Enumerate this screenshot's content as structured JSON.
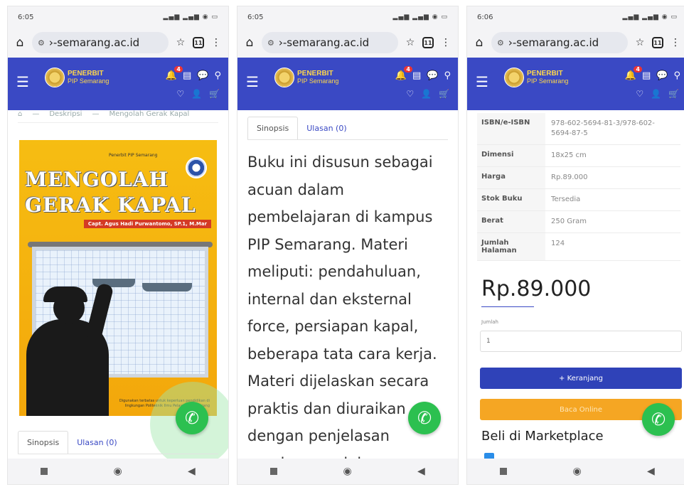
{
  "status": {
    "time1": "6:05",
    "time2": "6:05",
    "time3": "6:06",
    "signal": "▂▄▆ ▂▄▆ ■"
  },
  "browser": {
    "url": "›-semarang.ac.id",
    "tabs_count": "11"
  },
  "brand": {
    "line1": "PENERBIT",
    "line2": "PIP Semarang"
  },
  "nav": {
    "notif_count": "4"
  },
  "breadcrumb": {
    "item1": "⌂",
    "item2": "Deskripsi",
    "item3": "Mengolah Gerak Kapal"
  },
  "cover": {
    "publisher": "Penerbit PIP Semarang",
    "title_line1": "MENGOLAH",
    "title_line2": "GERAK KAPAL",
    "author": "Capt. Agus Hadi Purwantomo, SP.1, M.Mar",
    "footer_note": "Digunakan terbatas untuk keperluan pendidikan di lingkungan Politeknik Ilmu Pelayaran Semarang"
  },
  "tabs": {
    "synopsis": "Sinopsis",
    "reviews": "Ulasan (0)"
  },
  "synopsis_text": "Buku ini disusun sebagai acuan dalam pembelajaran di kampus PIP Semarang. Materi meliputi: pendahuluan, internal dan eksternal force, persiapan kapal, beberapa tata cara kerja. Materi dijelaskan secara praktis dan diuraikan dengan penjelasan gambar pendukung.",
  "specs": [
    {
      "key": "ISBN/e-ISBN",
      "value": "978-602-5694-81-3/978-602-5694-87-5"
    },
    {
      "key": "Dimensi",
      "value": "18x25 cm"
    },
    {
      "key": "Harga",
      "value": "Rp.89.000"
    },
    {
      "key": "Stok Buku",
      "value": "Tersedia"
    },
    {
      "key": "Berat",
      "value": "250 Gram"
    },
    {
      "key": "Jumlah Halaman",
      "value": "124"
    }
  ],
  "product": {
    "price": "Rp.89.000",
    "qty_label": "Jumlah",
    "qty_value": "1",
    "cart_button": "+ Keranjang",
    "read_button": "Baca Online",
    "marketplace_heading": "Beli di Marketplace"
  },
  "colors": {
    "navbar": "#3a49c4",
    "whatsapp": "#2cc050",
    "cart": "#2f42b8",
    "read": "#f5a623",
    "cover": "#f6bd12"
  }
}
